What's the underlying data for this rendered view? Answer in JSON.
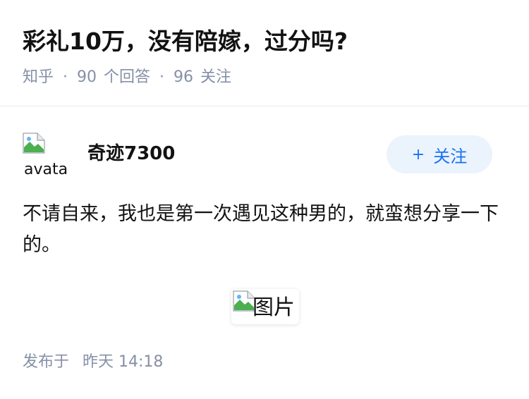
{
  "question": {
    "title": "彩礼10万，没有陪嫁，过分吗?",
    "source": "知乎",
    "separator": "·",
    "answers_count": "90",
    "answers_label": "个回答",
    "followers_count": "96",
    "followers_label": "关注"
  },
  "answer": {
    "avatar_alt": "avatar",
    "author": "奇迹7300",
    "follow_button": {
      "icon": "plus-icon",
      "plus": "+",
      "label": "关注"
    },
    "text": "不请自来，我也是第一次遇见这种男的，就蛮想分享一下的。",
    "image_alt": "图片",
    "published_label": "发布于",
    "published_time": "昨天 14:18"
  },
  "colors": {
    "text_primary": "#121212",
    "text_secondary": "#8590a6",
    "accent": "#1772f6",
    "follow_bg": "#ebf3fd"
  }
}
